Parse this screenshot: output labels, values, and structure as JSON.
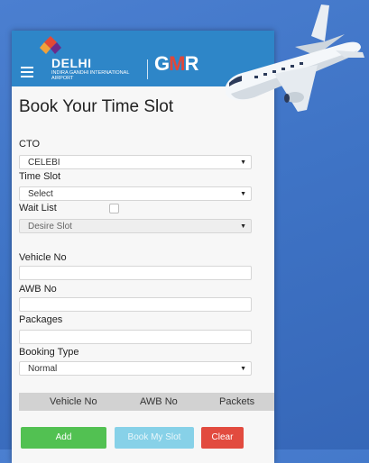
{
  "header": {
    "logo_city": "DELHI",
    "logo_subtitle": "INDIRA GANDHI INTERNATIONAL AIRPORT",
    "gmr_text_left": "G",
    "gmr_text_mid": "M",
    "gmr_text_right": "R"
  },
  "page_title": "Book Your Time Slot",
  "form": {
    "cto_label": "CTO",
    "cto_value": "CELEBI",
    "time_slot_label": "Time Slot",
    "time_slot_value": "Select",
    "wait_list_label": "Wait List",
    "desire_slot_value": "Desire Slot",
    "vehicle_no_label": "Vehicle No",
    "vehicle_no_value": "",
    "awb_no_label": "AWB No",
    "awb_no_value": "",
    "packages_label": "Packages",
    "packages_value": "",
    "booking_type_label": "Booking Type",
    "booking_type_value": "Normal"
  },
  "table": {
    "columns": [
      "Vehicle No",
      "AWB No",
      "Packets"
    ]
  },
  "buttons": {
    "add": "Add",
    "book": "Book My Slot",
    "clear": "Clear"
  },
  "colors": {
    "header": "#2e86c8",
    "add": "#52c152",
    "book": "#87d1e8",
    "clear": "#e24b3f",
    "background": "#3f74c6"
  }
}
